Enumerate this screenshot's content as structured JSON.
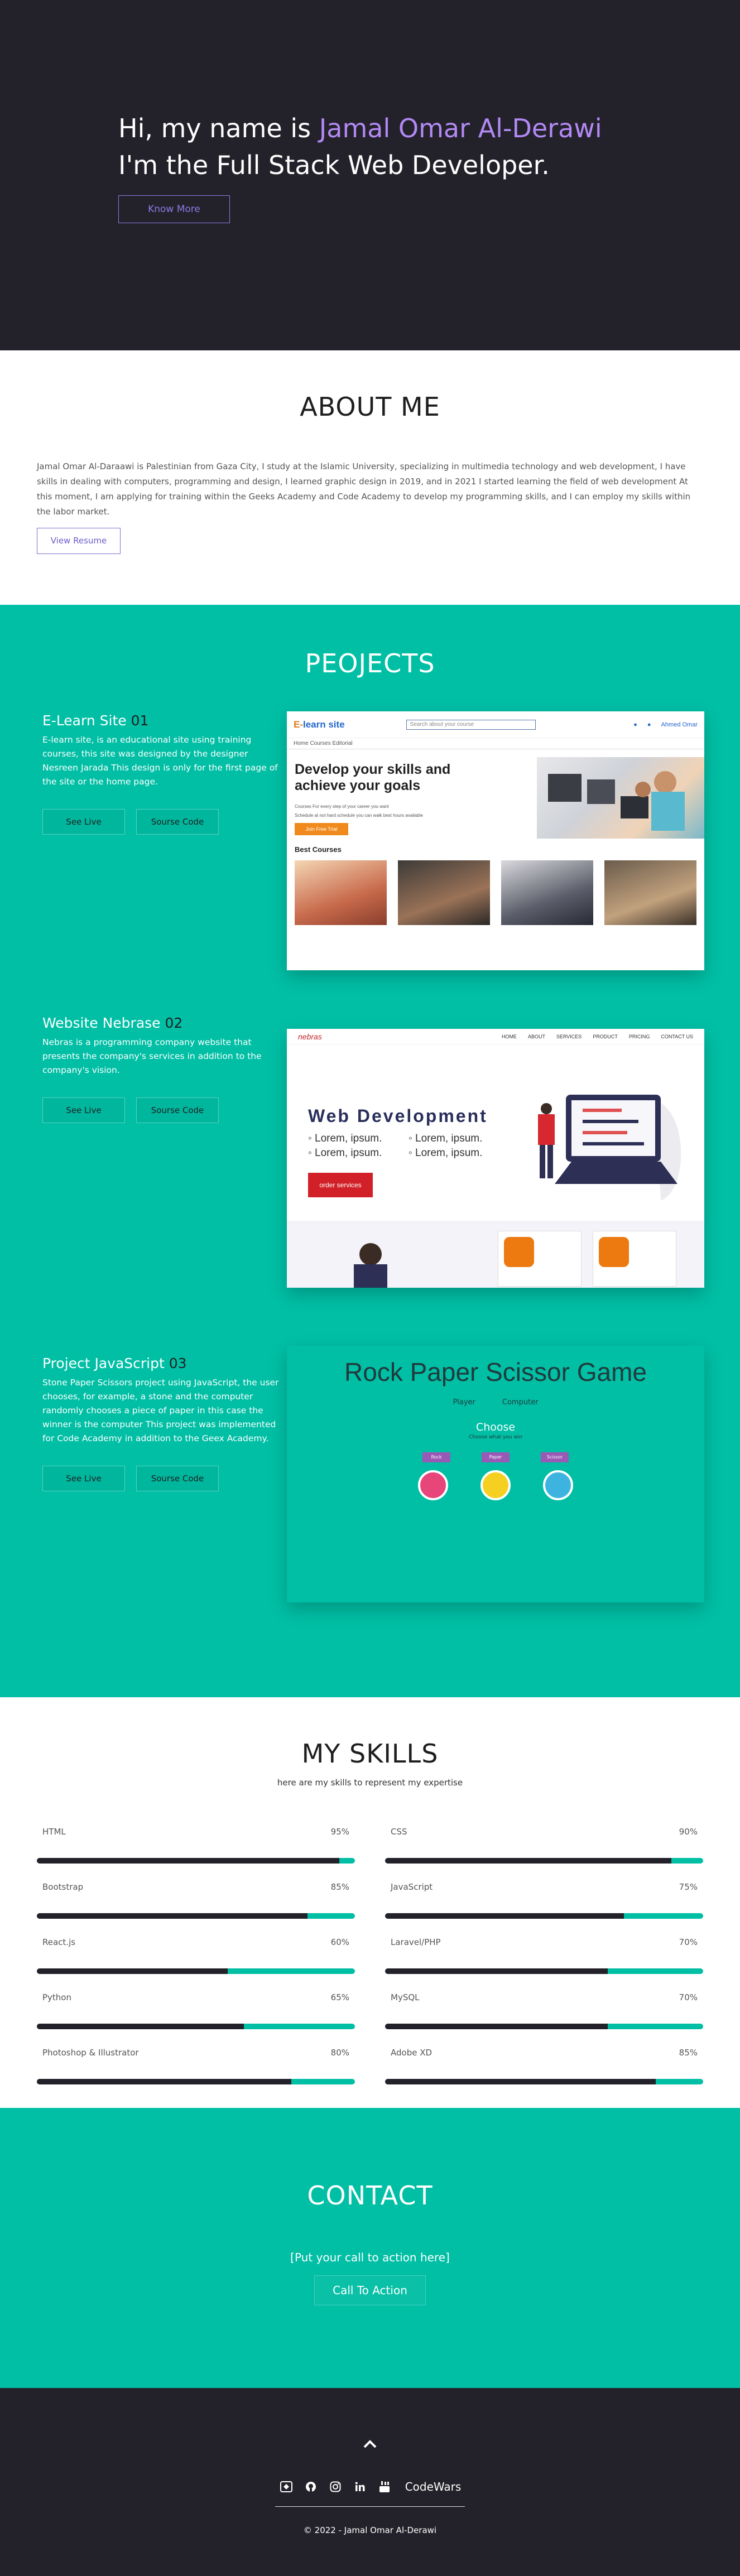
{
  "hero": {
    "greeting": "Hi, my name is ",
    "name": "Jamal Omar Al-Derawi",
    "role": "I'm the Full Stack Web Developer.",
    "button": "Know More"
  },
  "about": {
    "title": "ABOUT ME",
    "text": "Jamal Omar Al-Daraawi is Palestinian from Gaza City, I study at the Islamic University, specializing in multimedia technology and web development, I have skills in dealing with computers, programming and design, I learned graphic design in 2019, and in 2021 I started learning the field of web development At this moment, I am applying for training within the Geeks Academy and Code Academy to develop my programming skills, and I can employ my skills within the labor market.",
    "button": "View Resume"
  },
  "projects": {
    "title": "PEOJECTS",
    "items": [
      {
        "title": "E-Learn Site ",
        "num": "01",
        "desc": "E-learn site, is an educational site using training courses, this site was designed by the designer Nesreen Jarada This design is only for the first page of the site or the home page.",
        "live": "See Live",
        "source": "Sourse Code"
      },
      {
        "title": "Website Nebrase ",
        "num": "02",
        "desc": "Nebras is a programming company website that presents the company's services in addition to the company's vision.",
        "live": "See Live",
        "source": "Sourse Code"
      },
      {
        "title": "Project JavaScript ",
        "num": "03",
        "desc": "Stone Paper Scissors project using JavaScript, the user chooses, for example, a stone and the computer randomly chooses a piece of paper in this case the winner is the computer This project was implemented for Code Academy in addition to the Geex Academy.",
        "live": "See Live",
        "source": "Sourse Code"
      }
    ],
    "elearn": {
      "logo_e": "E-",
      "logo_rest": "learn site",
      "search": "Search about your course",
      "nav_user": "Ahmed Omar",
      "sub_nav": "Home    Courses    Editorial",
      "headline": "Develop your skills and achieve your goals",
      "line1": "Courses For every step of your career you want",
      "line2": "Schedule at not hard schedule you can walk best hours available",
      "join": "Join Free Trial",
      "best": "Best Courses"
    },
    "nebrase": {
      "logo": "nebras",
      "menu": [
        "HOME",
        "ABOUT",
        "SERVICES",
        "PRODUCT",
        "PRICING",
        "CONTACT US"
      ],
      "headline": "Web Development",
      "list": [
        "Lorem, ipsum.",
        "Lorem, ipsum.",
        "Lorem, ipsum.",
        "Lorem, ipsum."
      ],
      "button": "order services"
    },
    "rps": {
      "title": "Rock Paper Scissor Game",
      "player": "Player",
      "computer": "Computer",
      "choose": "Choose",
      "small": "Choose what you win",
      "buttons": [
        "Rock",
        "Paper",
        "Scissor"
      ]
    }
  },
  "skills": {
    "title": "MY SKILLS",
    "subtitle": "here are my skills to represent my expertise",
    "items": [
      {
        "name": "HTML",
        "pct": "95%",
        "value": 95
      },
      {
        "name": "CSS",
        "pct": "90%",
        "value": 90
      },
      {
        "name": "Bootstrap",
        "pct": "85%",
        "value": 85
      },
      {
        "name": "JavaScript",
        "pct": "75%",
        "value": 75
      },
      {
        "name": "React.js",
        "pct": "60%",
        "value": 60
      },
      {
        "name": "Laravel/PHP",
        "pct": "70%",
        "value": 70
      },
      {
        "name": "Python",
        "pct": "65%",
        "value": 65
      },
      {
        "name": "MySQL",
        "pct": "70%",
        "value": 70
      },
      {
        "name": "Photoshop & Illustrator",
        "pct": "80%",
        "value": 80
      },
      {
        "name": "Adobe XD",
        "pct": "85%",
        "value": 85
      }
    ]
  },
  "contact": {
    "title": "CONTACT",
    "cta_text": "[Put your call to action here]",
    "cta_button": "Call To Action"
  },
  "footer": {
    "socials": [
      "codepen-icon",
      "github-icon",
      "instagram-icon",
      "linkedin-icon",
      "youtube-icon"
    ],
    "codewars": "CodeWars",
    "copyright": "© 2022 - Jamal Omar Al-Derawi"
  },
  "colors": {
    "dark": "#23222a",
    "teal": "#00bfa5",
    "purple": "#b389f5"
  }
}
